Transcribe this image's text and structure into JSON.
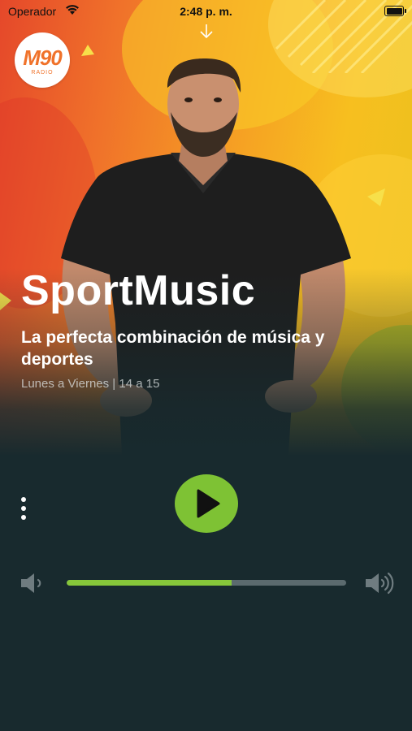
{
  "status_bar": {
    "carrier": "Operador",
    "time": "2:48 p. m.",
    "wifi_icon": "wifi-icon",
    "battery_icon": "battery-icon"
  },
  "logo": {
    "text": "M90",
    "subtext": "RADIO"
  },
  "show": {
    "title": "SportMusic",
    "subtitle": "La perfecta combinación de música y deportes",
    "schedule": "Lunes a Viernes | 14 a 15"
  },
  "player": {
    "state": "paused",
    "play_icon": "play-icon",
    "menu_icon": "more-vertical-icon",
    "volume": 0.59,
    "volume_low_icon": "volume-low-icon",
    "volume_high_icon": "volume-high-icon"
  },
  "colors": {
    "accent_green": "#7ec234",
    "background": "#182a2e",
    "hero_orange": "#f0722a",
    "hero_yellow": "#f7bf1f"
  }
}
